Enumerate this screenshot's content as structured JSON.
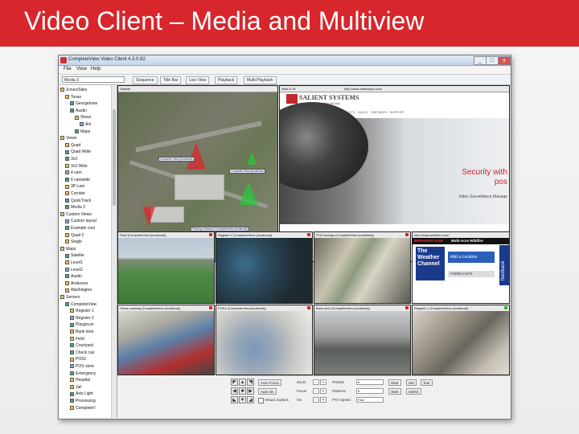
{
  "slide": {
    "title": "Video Client – Media and Multiview"
  },
  "window": {
    "title": "CompleteView Video Client 4.3.0.82",
    "buttons": [
      "_",
      "□",
      "x"
    ]
  },
  "menu": [
    "File",
    "View",
    "Help"
  ],
  "toolbar": {
    "view_select": "Media 3",
    "buttons": [
      "Sequence",
      "Title Bar",
      "Live View",
      "Playback",
      "Multi-Playback"
    ]
  },
  "tree": [
    {
      "label": "Zones/Sites",
      "level": 0
    },
    {
      "label": "Texas",
      "level": 1
    },
    {
      "label": "Georgetown",
      "level": 2
    },
    {
      "label": "Austin",
      "level": 2
    },
    {
      "label": "Views",
      "level": 3
    },
    {
      "label": "Ani",
      "level": 4
    },
    {
      "label": "Maps",
      "level": 3
    },
    {
      "label": "Views",
      "level": 0
    },
    {
      "label": "Quad",
      "level": 1
    },
    {
      "label": "Quad Wide",
      "level": 1
    },
    {
      "label": "3x3",
      "level": 1
    },
    {
      "label": "3x3 Wide",
      "level": 1
    },
    {
      "label": "4 cam",
      "level": 1
    },
    {
      "label": "6 camwide",
      "level": 1
    },
    {
      "label": "3P Lam",
      "level": 1
    },
    {
      "label": "Corridor",
      "level": 1
    },
    {
      "label": "QuickTrack",
      "level": 1
    },
    {
      "label": "Media 3",
      "level": 1
    },
    {
      "label": "Custom Views",
      "level": 0
    },
    {
      "label": "Custom layout",
      "level": 1
    },
    {
      "label": "Example cust",
      "level": 1
    },
    {
      "label": "Quad 2",
      "level": 1
    },
    {
      "label": "Single",
      "level": 1
    },
    {
      "label": "Maps",
      "level": 0
    },
    {
      "label": "Satelite",
      "level": 1
    },
    {
      "label": "Level1",
      "level": 1
    },
    {
      "label": "Level2",
      "level": 1
    },
    {
      "label": "Austin",
      "level": 1
    },
    {
      "label": "Anderson",
      "level": 1
    },
    {
      "label": "Washington",
      "level": 1
    },
    {
      "label": "Servers",
      "level": 0
    },
    {
      "label": "CompleteView",
      "level": 1
    },
    {
      "label": "Register 1",
      "level": 2
    },
    {
      "label": "Register 2",
      "level": 2
    },
    {
      "label": "Playgroun",
      "level": 2
    },
    {
      "label": "Bank door",
      "level": 2
    },
    {
      "label": "Field",
      "level": 2
    },
    {
      "label": "Courtyard",
      "level": 2
    },
    {
      "label": "Check cas",
      "level": 2
    },
    {
      "label": "POS1",
      "level": 2
    },
    {
      "label": "POS store",
      "level": 2
    },
    {
      "label": "Emergency",
      "level": 2
    },
    {
      "label": "Hospital",
      "level": 2
    },
    {
      "label": "Jail",
      "level": 2
    },
    {
      "label": "Axis Light",
      "level": 2
    },
    {
      "label": "Processing",
      "level": 2
    },
    {
      "label": "CompleteV",
      "level": 2
    }
  ],
  "tiles": {
    "map": {
      "label": "Satelite",
      "annotations": [
        "Complete View (localhost)",
        "Complete View (localhost)",
        "Parking entrance (CompleteView (localhost))"
      ]
    },
    "web": {
      "header_select": "Web In St",
      "url": "http://www.salientsys.com/",
      "logo": "SALIENT SYSTEMS",
      "tagline": "Simple Scalable Security",
      "nav": [
        "HOME",
        "ABOUT US",
        "VERTICALS",
        "PRODUCTS",
        "SALES",
        "PARTNERS",
        "SUPPORT"
      ],
      "hero_line1": "Security with",
      "hero_line2": "pos",
      "hero_line3": "Video Surveillance Manage"
    },
    "field": {
      "label": "Field (CompleteView (localhost))"
    },
    "register2": {
      "label": "Register 2 (CompleteView (localhost))"
    },
    "posstorage": {
      "label": "POS storage (CompleteView (localhost))"
    },
    "weather": {
      "url": "http://www.weather.com/",
      "breaking": "BREAKING NOW",
      "breaking_text": "Multi-Acre Wildfire",
      "logo": "The Weather Channel",
      "promo": "Add a Location",
      "forecasts": "FORECASTS",
      "feedback": "feedback"
    },
    "checkcashing": {
      "label": "Check cashing (CompleteView (localhost))"
    },
    "pos1": {
      "label": "POS1 (CompleteView (localhost))"
    },
    "backdoor": {
      "label": "Back door (CompleteView (localhost))"
    },
    "register1": {
      "label": "Register 1 (CompleteView (localhost))"
    }
  },
  "controls": {
    "ptz": [
      "◤",
      "▲",
      "◥",
      "◀",
      "■",
      "▶",
      "◣",
      "▼",
      "◢"
    ],
    "rows": [
      {
        "label": "Auto Focus",
        "field": "Zoom",
        "select_label": "Presets",
        "button": "Start",
        "button2": "Set",
        "button3": "Tour"
      },
      {
        "label": "Auto Iris",
        "field": "Focus",
        "select_label": "Patterns",
        "button": "Start",
        "button2": "Select"
      },
      {
        "label": "Virtual Joystick",
        "field": "Iris",
        "select_label": "PTZ Speed",
        "select_value": "Fast"
      }
    ]
  }
}
